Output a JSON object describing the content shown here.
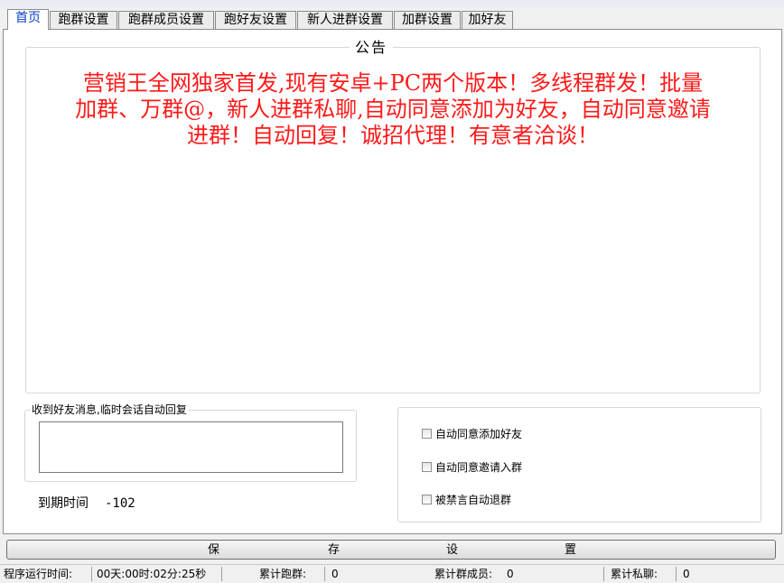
{
  "tabs": [
    {
      "label": "首页",
      "active": true
    },
    {
      "label": "跑群设置",
      "active": false
    },
    {
      "label": "跑群成员设置",
      "active": false
    },
    {
      "label": "跑好友设置",
      "active": false
    },
    {
      "label": "新人进群设置",
      "active": false
    },
    {
      "label": "加群设置",
      "active": false
    },
    {
      "label": "加好友",
      "active": false
    }
  ],
  "notice": {
    "title": "公告",
    "text": "营销王全网独家首发,现有安卓+PC两个版本！多线程群发！批量加群、万群@，新人进群私聊,自动同意添加为好友，自动同意邀请进群！自动回复！诚招代理！有意者洽谈！",
    "color": "#ff1a1a"
  },
  "auto_reply": {
    "title": "收到好友消息,临时会话自动回复",
    "value": ""
  },
  "expire": {
    "label": "到期时间",
    "value": "-102"
  },
  "options": [
    {
      "label": "自动同意添加好友",
      "checked": false
    },
    {
      "label": "自动同意邀请入群",
      "checked": false
    },
    {
      "label": "被禁言自动退群",
      "checked": false
    }
  ],
  "save_button": {
    "chars": [
      "保",
      "存",
      "设",
      "置"
    ]
  },
  "status": {
    "runtime_label": "程序运行时间:",
    "runtime_value": "00天:00时:02分:25秒",
    "groups_label": "累计跑群:",
    "groups_value": "0",
    "members_label": "累计群成员:",
    "members_value": "0",
    "private_label": "累计私聊:",
    "private_value": "0"
  }
}
